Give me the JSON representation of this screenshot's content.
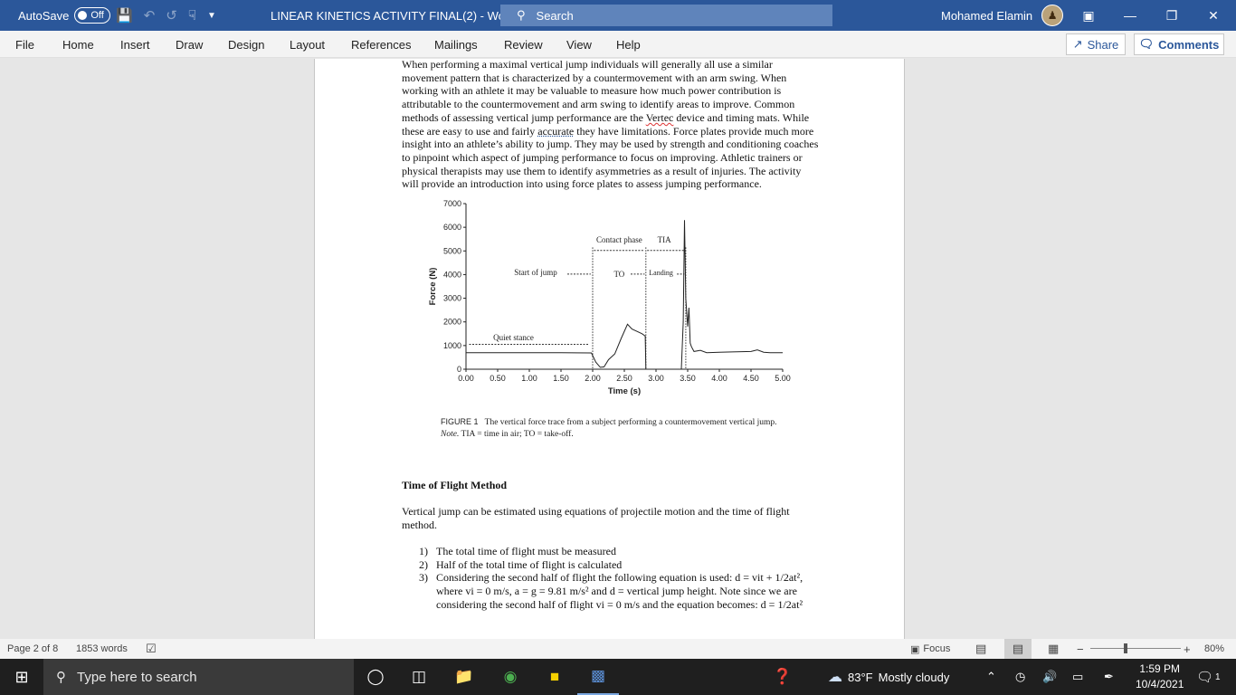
{
  "titlebar": {
    "autosave_label": "AutoSave",
    "autosave_state": "Off",
    "document_title": "LINEAR KINETICS ACTIVITY FINAL(2)",
    "separator": "-",
    "app_name": "Word",
    "search_placeholder": "Search",
    "user_name": "Mohamed Elamin",
    "accent_color": "#2b579a"
  },
  "ribbon": {
    "tabs": [
      "File",
      "Home",
      "Insert",
      "Draw",
      "Design",
      "Layout",
      "References",
      "Mailings",
      "Review",
      "View",
      "Help"
    ],
    "share_label": "Share",
    "comments_label": "Comments"
  },
  "document": {
    "intro": {
      "part1": "When performing a maximal vertical jump individuals will generally all use a similar movement pattern that is characterized by a countermovement with an arm swing. When working with an athlete it may be valuable to measure how much power contribution is attributable to the countermovement and arm swing to identify areas to improve. Common methods of assessing vertical jump performance are the ",
      "vertec": "Vertec",
      "part2": " device and timing mats. While these are easy to use and fairly ",
      "accurate": "accurate",
      "part3": " they have limitations. Force plates provide much more insight into an athlete’s ability to jump. They may be used by strength and conditioning coaches to pinpoint which aspect of jumping performance to focus on improving. Athletic trainers or physical therapists may use them to identify asymmetries as a result of injuries. The activity will provide an introduction into using force plates to assess jumping performance."
    },
    "figure": {
      "caption_label": "FIGURE 1",
      "caption_text": "The vertical force trace from a subject performing a countermovement vertical jump.",
      "note_label": "Note.",
      "note_text": " TIA = time in air; TO = take-off."
    },
    "heading": "Time of Flight Method",
    "paragraph2": "Vertical jump can be estimated using equations of projectile motion and the time of flight method.",
    "list": [
      {
        "num": "1)",
        "text": "The total time of flight must be measured"
      },
      {
        "num": "2)",
        "text": "Half of the total time of flight is calculated"
      },
      {
        "num": "3)",
        "text": "Considering the second half of flight the following equation is used: d = vit + 1/2at², where vi = 0 m/s, a = g = 9.81 m/s² and d = vertical jump height. Note since we are considering the second half of flight vi = 0 m/s and the equation becomes: d = 1/2at²"
      }
    ]
  },
  "chart_data": {
    "type": "line",
    "title": "",
    "xlabel": "Time (s)",
    "ylabel": "Force (N)",
    "xlim": [
      0,
      5
    ],
    "ylim": [
      0,
      7000
    ],
    "x_ticks": [
      "0.00",
      "0.50",
      "1.00",
      "1.50",
      "2.00",
      "2.50",
      "3.00",
      "3.50",
      "4.00",
      "4.50",
      "5.00"
    ],
    "y_ticks": [
      "0",
      "1000",
      "2000",
      "3000",
      "4000",
      "5000",
      "6000",
      "7000"
    ],
    "grid": false,
    "series": [
      {
        "x": [
          0.0,
          0.5,
          1.0,
          1.5,
          1.98,
          2.05,
          2.12,
          2.18,
          2.25,
          2.35,
          2.45,
          2.55,
          2.62,
          2.7,
          2.78,
          2.83,
          2.84,
          2.9,
          3.0,
          3.2,
          3.4,
          3.43,
          3.45,
          3.47,
          3.5,
          3.52,
          3.54,
          3.56,
          3.6,
          3.7,
          3.8,
          4.0,
          4.2,
          4.5,
          4.6,
          4.7,
          4.8,
          5.0
        ],
        "y": [
          700,
          700,
          700,
          700,
          690,
          300,
          80,
          100,
          400,
          650,
          1300,
          1900,
          1700,
          1600,
          1500,
          1400,
          0,
          0,
          0,
          0,
          0,
          2000,
          6300,
          3000,
          1800,
          2600,
          1100,
          950,
          750,
          800,
          700,
          720,
          730,
          750,
          820,
          720,
          700,
          700
        ]
      }
    ],
    "annotations": [
      "Quiet stance",
      "Start of jump",
      "Contact phase",
      "TIA",
      "TO",
      "Landing"
    ]
  },
  "statusbar": {
    "page": "Page 2 of 8",
    "words": "1853 words",
    "focus": "Focus",
    "zoom_minus": "−",
    "zoom_plus": "+",
    "zoom": "80%"
  },
  "taskbar": {
    "search_placeholder": "Type here to search",
    "temperature": "83°F",
    "weather": "Mostly cloudy",
    "time": "1:59 PM",
    "date": "10/4/2021",
    "notifications": "1"
  }
}
